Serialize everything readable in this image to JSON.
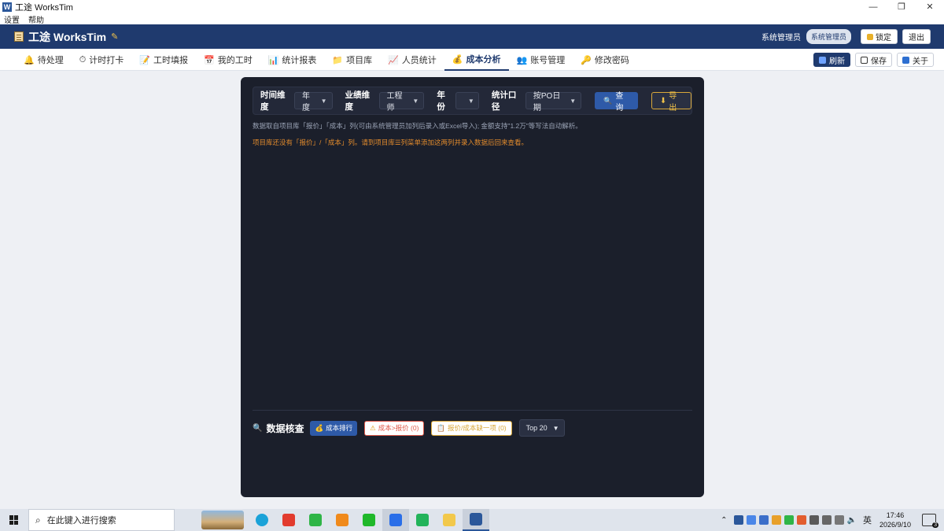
{
  "window": {
    "app_icon": "W",
    "title": "工途 WorksTim",
    "controls": [
      "—",
      "❐",
      "✕"
    ]
  },
  "menu": [
    "设置",
    "帮助"
  ],
  "header": {
    "brand": "工途 WorksTim",
    "user": "系统管理员",
    "role": "系统管理员",
    "lock_label": "锁定",
    "logout_label": "退出",
    "colors": {
      "bar": "#1f3a6e"
    }
  },
  "nav": {
    "tabs": [
      {
        "icon": "bell-icon",
        "glyph": "🔔",
        "label": "待处理"
      },
      {
        "icon": "stopwatch-icon",
        "glyph": "⏱",
        "label": "计时打卡"
      },
      {
        "icon": "notepad-icon",
        "glyph": "📝",
        "label": "工时填报"
      },
      {
        "icon": "calendar-icon",
        "glyph": "📅",
        "label": "我的工时"
      },
      {
        "icon": "bar-chart-icon",
        "glyph": "📊",
        "label": "统计报表"
      },
      {
        "icon": "folder-icon",
        "glyph": "📁",
        "label": "项目库"
      },
      {
        "icon": "chart-trend-icon",
        "glyph": "📈",
        "label": "人员统计"
      },
      {
        "icon": "money-bag-icon",
        "glyph": "💰",
        "label": "成本分析",
        "active": true
      },
      {
        "icon": "users-icon",
        "glyph": "👥",
        "label": "账号管理"
      },
      {
        "icon": "key-icon",
        "glyph": "🔑",
        "label": "修改密码"
      }
    ],
    "actions": {
      "refresh": "刷新",
      "save": "保存",
      "about": "关于"
    }
  },
  "filters": {
    "time_dim_label": "时间维度",
    "time_dim_value": "年度",
    "biz_dim_label": "业绩维度",
    "biz_dim_value": "工程师",
    "year_label": "年份",
    "year_value": "",
    "scope_label": "统计口径",
    "scope_value": "按PO日期",
    "query_label": "查询",
    "export_label": "导出"
  },
  "messages": {
    "note": "数据取自项目库「报价」「成本」列(可由系统管理员加列后录入或Excel导入); 金额支持\"1.2万\"等写法自动解析。",
    "warning": "项目库还没有「报价」/「成本」列。请到项目库☰列菜单添加这两列并录入数据后回来查看。"
  },
  "check": {
    "title": "数据核查",
    "rank_label": "成本排行",
    "over_label": "成本>报价 (0)",
    "missing_label": "报价/成本缺一项 (0)",
    "top_value": "Top 20"
  },
  "taskbar": {
    "search_placeholder": "在此键入进行搜索",
    "lang": "英",
    "time": "17:46",
    "date": "2026/9/10",
    "notifications": "3"
  }
}
